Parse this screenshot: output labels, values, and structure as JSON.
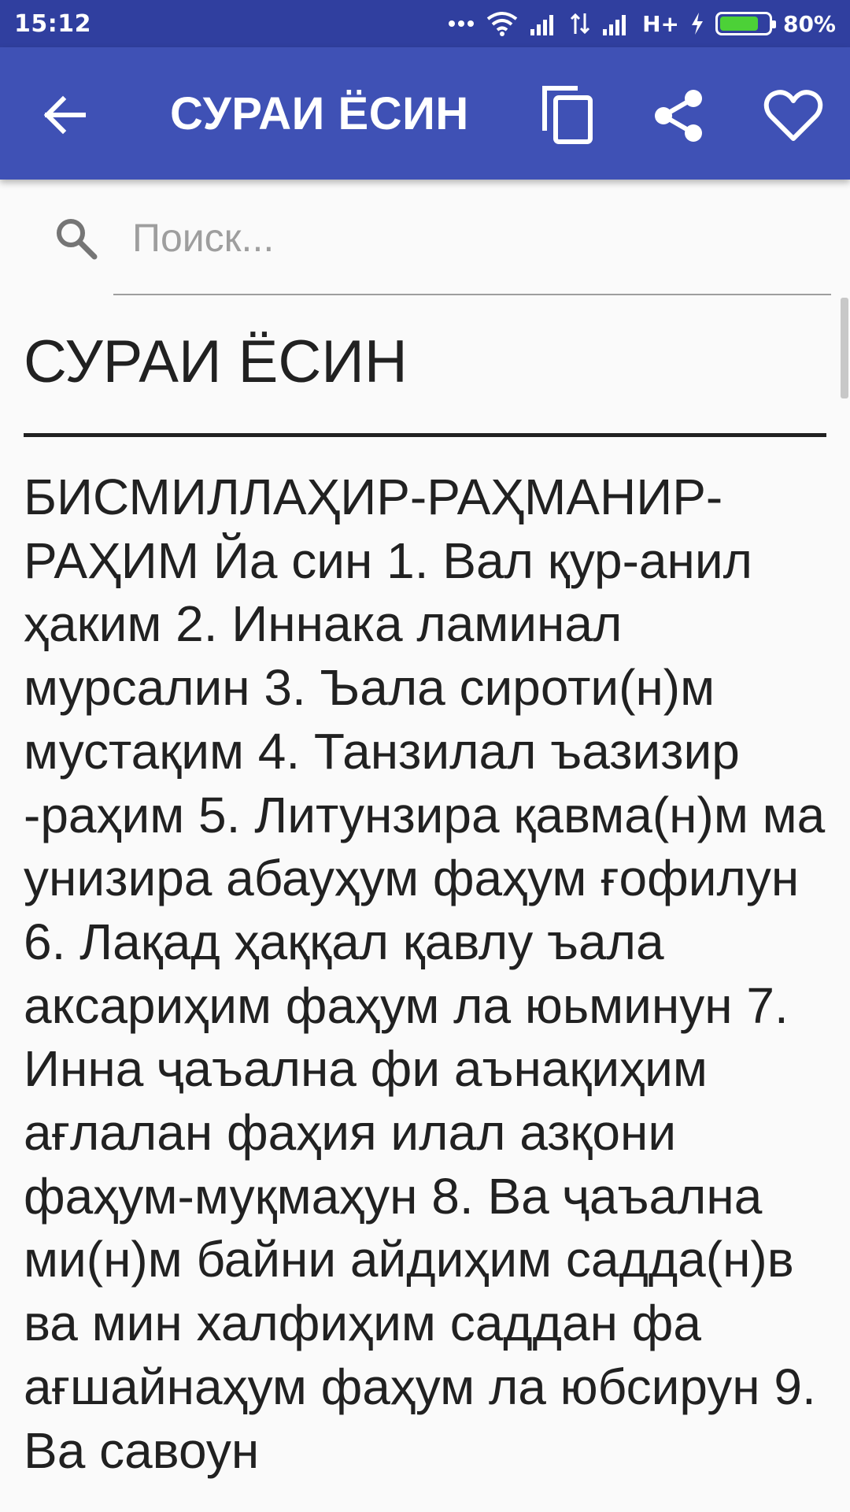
{
  "status_bar": {
    "time": "15:12",
    "network": "H+",
    "battery": "80%",
    "battery_level": 0.8
  },
  "app_bar": {
    "title": "СУРАИ ЁСИН",
    "icons": [
      "back-arrow-icon",
      "copy-icon",
      "share-icon",
      "favorite-heart-icon"
    ]
  },
  "search": {
    "placeholder": "Поиск..."
  },
  "content": {
    "heading": "СУРАИ ЁСИН",
    "text": "БИСМИЛЛАҲИР-РАҲМАНИР-РАҲИМ Йа син 1. Вал қур-анил ҳаким 2. Иннака ламинал мурсалин 3. Ъала сироти(н)м мустақим 4. Танзилал ъазизир -раҳим 5. Литунзира қавма(н)м ма унизира абауҳум фаҳум ғофилун 6. Лақад ҳаққал қавлу ъала аксариҳим фаҳум ла юьминун 7. Инна ҷаъална фи аънақиҳим ағлалан фаҳия илал азқони фаҳум-муқмаҳун 8. Ва ҷаъална ми(н)м байни айдиҳим садда(н)в ва мин халфиҳим саддан фа ағшайнаҳум фаҳум ла юбсирун 9. Ва савоун"
  },
  "colors": {
    "status_bar": "#303f9f",
    "app_bar": "#3f51b5",
    "background": "#fafafa",
    "text": "#212121"
  }
}
